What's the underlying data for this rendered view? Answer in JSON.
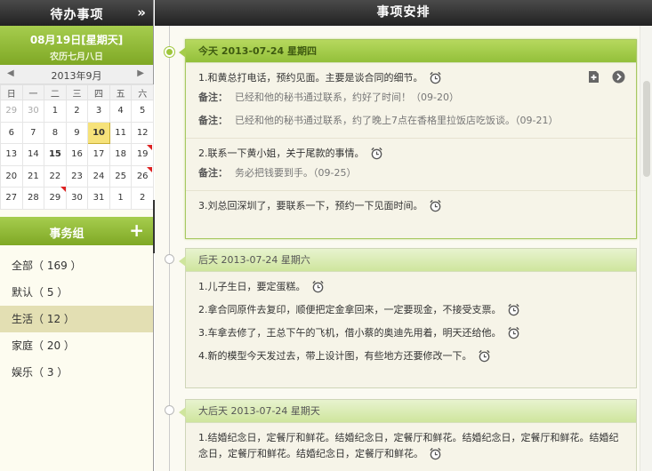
{
  "left": {
    "title": "待办事项",
    "collapse_icon": "»",
    "date_line1": "08月19日[星期天]",
    "date_line2": "农历七月八日",
    "month_label": "2013年9月",
    "weekdays": [
      "日",
      "一",
      "二",
      "三",
      "四",
      "五",
      "六"
    ],
    "weeks": [
      [
        "29",
        "30",
        "1",
        "2",
        "3",
        "4",
        "5"
      ],
      [
        "6",
        "7",
        "8",
        "9",
        "10",
        "11",
        "12"
      ],
      [
        "13",
        "14",
        "15",
        "16",
        "17",
        "18",
        "19"
      ],
      [
        "20",
        "21",
        "22",
        "23",
        "24",
        "25",
        "26"
      ],
      [
        "27",
        "28",
        "29",
        "30",
        "31",
        "1",
        "2"
      ]
    ],
    "group_title": "事务组",
    "groups": [
      {
        "label": "全部（ 169 ）"
      },
      {
        "label": "默认（ 5 ）"
      },
      {
        "label": "生活（ 12 ）"
      },
      {
        "label": "家庭（ 20 ）"
      },
      {
        "label": "娱乐（ 3 ）"
      }
    ]
  },
  "right": {
    "title": "事项安排",
    "sections": [
      {
        "header": "今天  2013-07-24  星期四",
        "items": [
          {
            "text": "1.和黄总打电话，预约见面。主要是谈合同的细节。",
            "notes": [
              {
                "label": "备注：",
                "text": "已经和他的秘书通过联系，约好了时间！（09-20）"
              },
              {
                "label": "备注：",
                "text": "已经和他的秘书通过联系，约了晚上7点在香格里拉饭店吃饭谈。（09-21）"
              }
            ]
          },
          {
            "text": "2.联系一下黄小姐，关于尾款的事情。",
            "notes": [
              {
                "label": "备注：",
                "text": "务必把钱要到手。（09-25）"
              }
            ]
          },
          {
            "text": "3.刘总回深圳了，要联系一下，预约一下见面时间。"
          }
        ]
      },
      {
        "header": "后天  2013-07-24  星期六",
        "items": [
          {
            "text": "1.儿子生日，要定蛋糕。"
          },
          {
            "text": "2.拿合同原件去复印，顺便把定金拿回来，一定要现金，不接受支票。"
          },
          {
            "text": "3.车拿去修了，王总下午的飞机，借小蔡的奥迪先用着，明天还给他。"
          },
          {
            "text": "4.新的模型今天发过去，带上设计图，有些地方还要修改一下。"
          }
        ]
      },
      {
        "header": "大后天  2013-07-24  星期天",
        "items": [
          {
            "text": "1.结婚纪念日，定餐厅和鲜花。结婚纪念日，定餐厅和鲜花。结婚纪念日，定餐厅和鲜花。结婚纪念日，定餐厅和鲜花。结婚纪念日，定餐厅和鲜花。"
          }
        ]
      }
    ]
  }
}
